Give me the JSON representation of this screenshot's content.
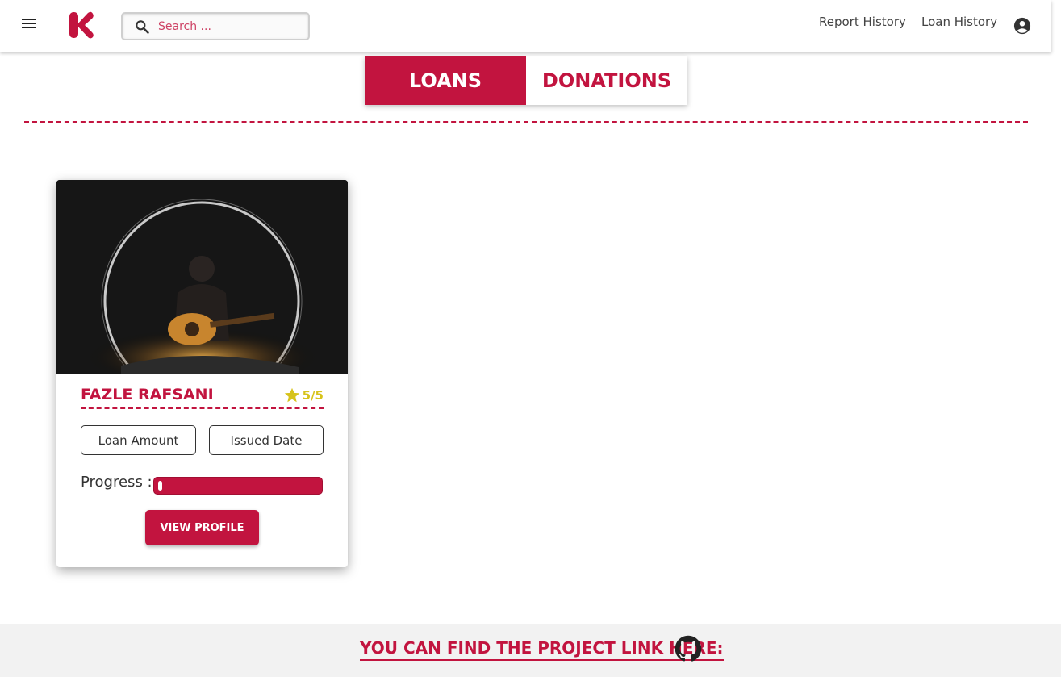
{
  "header": {
    "menu_icon": "hamburger-menu-icon",
    "logo_letter": "K",
    "search": {
      "placeholder": "Search ...",
      "value": "",
      "icon": "search-icon"
    },
    "nav_links": [
      "Report History",
      "Loan History"
    ],
    "account_icon": "account-circle-icon"
  },
  "tabs": [
    {
      "label": "LOANS",
      "active": true
    },
    {
      "label": "DONATIONS",
      "active": false
    }
  ],
  "card": {
    "image_description_icon": "person-with-guitar-photo",
    "name": "FAZLE RAFSANI",
    "rating": "5/5",
    "rating_icon": "star-icon",
    "loan_amount_label": "Loan Amount",
    "issued_date_label": "Issued Date",
    "progress_label": "Progress :",
    "progress_fraction": 0.02,
    "button_label": "VIEW PROFILE"
  },
  "footer": {
    "text": "YOU CAN FIND THE PROJECT LINK HERE:",
    "icon": "github-icon"
  },
  "colors": {
    "accent": "#c2143f",
    "star": "#d7c31b",
    "footer_bg": "#f2f2f2"
  }
}
